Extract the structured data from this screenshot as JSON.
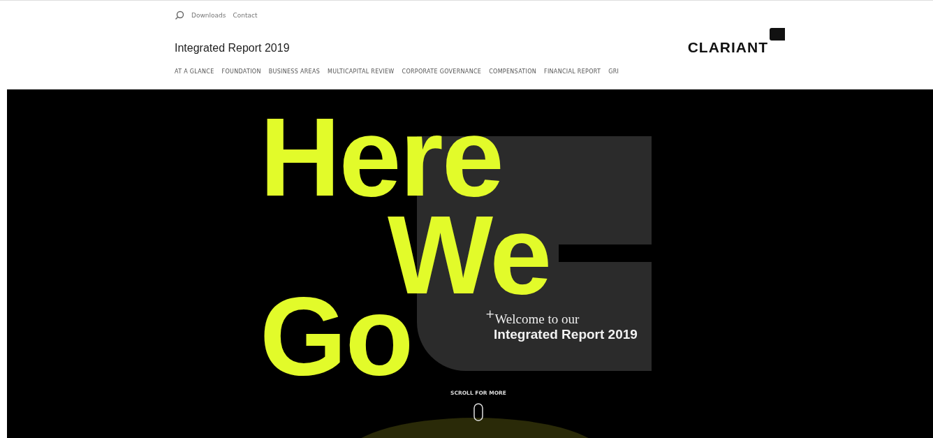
{
  "top_links": [
    "Downloads",
    "Contact"
  ],
  "site_title": "Integrated Report 2019",
  "logo": "CLARIANT",
  "nav": [
    {
      "label": "AT A GLANCE",
      "selected": false
    },
    {
      "label": "FOUNDATION",
      "selected": false
    },
    {
      "label": "BUSINESS AREAS",
      "selected": false
    },
    {
      "label": "MULTICAPITAL REVIEW",
      "selected": false
    },
    {
      "label": "CORPORATE GOVERNANCE",
      "selected": false
    },
    {
      "label": "COMPENSATION",
      "selected": false
    },
    {
      "label": "FINANCIAL REPORT",
      "selected": false
    },
    {
      "label": "GRI",
      "selected": false
    }
  ],
  "hero": {
    "headline": [
      "Here",
      "We",
      "Go"
    ],
    "plus": "+",
    "welcome": "Welcome to our",
    "subtitle": "Integrated Report 2019",
    "scroll_hint": "SCROLL FOR MORE"
  }
}
